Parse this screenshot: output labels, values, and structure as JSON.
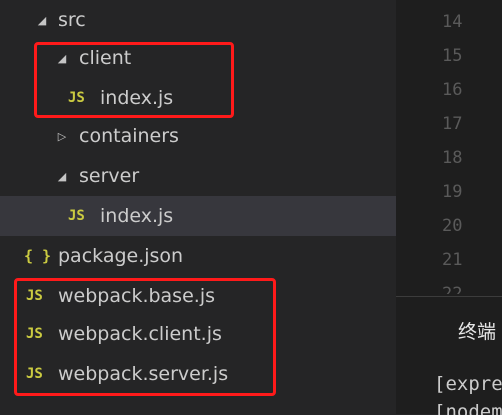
{
  "explorer": {
    "items": [
      {
        "label": "src",
        "kind": "folder-open",
        "icon_glyph": "◢"
      },
      {
        "label": "client",
        "kind": "folder-open",
        "icon_glyph": "◢"
      },
      {
        "label": "index.js",
        "kind": "js-file",
        "icon_glyph": "JS"
      },
      {
        "label": "containers",
        "kind": "folder-closed",
        "icon_glyph": "▷"
      },
      {
        "label": "server",
        "kind": "folder-open",
        "icon_glyph": "◢"
      },
      {
        "label": "index.js",
        "kind": "js-file",
        "icon_glyph": "JS"
      },
      {
        "label": "package.json",
        "kind": "json-file",
        "icon_glyph": "{ }"
      },
      {
        "label": "webpack.base.js",
        "kind": "js-file",
        "icon_glyph": "JS"
      },
      {
        "label": "webpack.client.js",
        "kind": "js-file",
        "icon_glyph": "JS"
      },
      {
        "label": "webpack.server.js",
        "kind": "js-file",
        "icon_glyph": "JS"
      }
    ]
  },
  "editor": {
    "line_numbers": [
      "14",
      "15",
      "16",
      "17",
      "18",
      "19",
      "20",
      "21",
      "22"
    ]
  },
  "panel": {
    "tab_label": "终端",
    "terminal_lines": [
      "[expre",
      "[nodem"
    ]
  },
  "colors": {
    "highlight": "#ff1a1a",
    "js_icon": "#cbcb41",
    "selected_row": "#37373d"
  }
}
